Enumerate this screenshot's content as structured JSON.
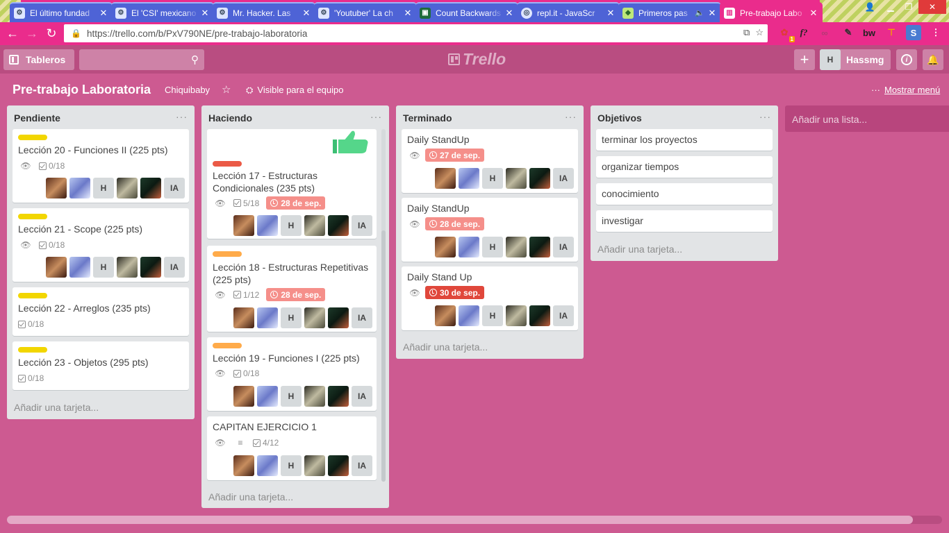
{
  "browser": {
    "tabs": [
      {
        "title": "El último fundad",
        "icon": "tab-favicon"
      },
      {
        "title": "El 'CSI' mexicano",
        "icon": "tab-favicon"
      },
      {
        "title": "Mr. Hacker. Las",
        "icon": "tab-favicon"
      },
      {
        "title": "'Youtuber' La ch",
        "icon": "tab-favicon"
      },
      {
        "title": "Count Backwards",
        "icon": "tab-favicon"
      },
      {
        "title": "repl.it - JavaScr",
        "icon": "tab-favicon"
      },
      {
        "title": "Primeros pas",
        "icon": "tab-favicon"
      },
      {
        "title": "Pre-trabajo Labo",
        "icon": "trello-favicon"
      }
    ],
    "url": "https://trello.com/b/PxV790NE/pre-trabajo-laboratoria",
    "extension_badge": "1"
  },
  "header": {
    "boards_label": "Tableros",
    "logo_text": "Trello",
    "user_initial": "H",
    "user_name": "Hassmg"
  },
  "board": {
    "title": "Pre-trabajo Laboratoria",
    "team": "Chiquibaby",
    "visibility": "Visible para el equipo",
    "menu_label": "Mostrar menú",
    "add_list": "Añadir una lista..."
  },
  "lists": [
    {
      "name": "Pendiente",
      "add_card": "Añadir una tarjeta...",
      "cards": [
        {
          "label_color": "#f2d600",
          "title": "Lección 20 - Funciones II (225 pts)",
          "checklist": "0/18"
        },
        {
          "label_color": "#f2d600",
          "title": "Lección 21 - Scope (225 pts)",
          "checklist": "0/18"
        },
        {
          "label_color": "#f2d600",
          "title": "Lección 22 - Arreglos (235 pts)",
          "checklist": "0/18"
        },
        {
          "label_color": "#f2d600",
          "title": "Lección 23 - Objetos (295 pts)",
          "checklist": "0/18"
        }
      ]
    },
    {
      "name": "Haciendo",
      "add_card": "Añadir una tarjeta...",
      "cards": [
        {
          "label_color": "#eb5a46",
          "title_line1": "Lección 17 - Estructuras",
          "title_line2": "Condicionales (235 pts)",
          "checklist": "5/18",
          "due": "28 de sep."
        },
        {
          "label_color": "#ffab4a",
          "title_line1": "Lección 18 - Estructuras Repetitivas",
          "title_line2": "(225 pts)",
          "checklist": "1/12",
          "due": "28 de sep."
        },
        {
          "label_color": "#ffab4a",
          "title": "Lección 19 - Funciones I (225 pts)",
          "checklist": "0/18"
        },
        {
          "title": "CAPITAN EJERCICIO 1",
          "checklist": "4/12"
        }
      ]
    },
    {
      "name": "Terminado",
      "add_card": "Añadir una tarjeta...",
      "cards": [
        {
          "title": "Daily StandUp",
          "due": "27 de sep."
        },
        {
          "title": "Daily StandUp",
          "due": "28 de sep."
        },
        {
          "title": "Daily Stand Up",
          "due": "30 de sep."
        }
      ]
    },
    {
      "name": "Objetivos",
      "add_card": "Añadir una tarjeta...",
      "cards": [
        {
          "title": "terminar los proyectos"
        },
        {
          "title": "organizar tiempos"
        },
        {
          "title": "conocimiento"
        },
        {
          "title": "investigar"
        }
      ]
    }
  ],
  "member_initials": {
    "h": "H",
    "ia": "IA"
  },
  "colors": {
    "board_bg": "#cd5a91",
    "due_soon": "#f58f8a",
    "due_overdue": "#e0473b"
  }
}
